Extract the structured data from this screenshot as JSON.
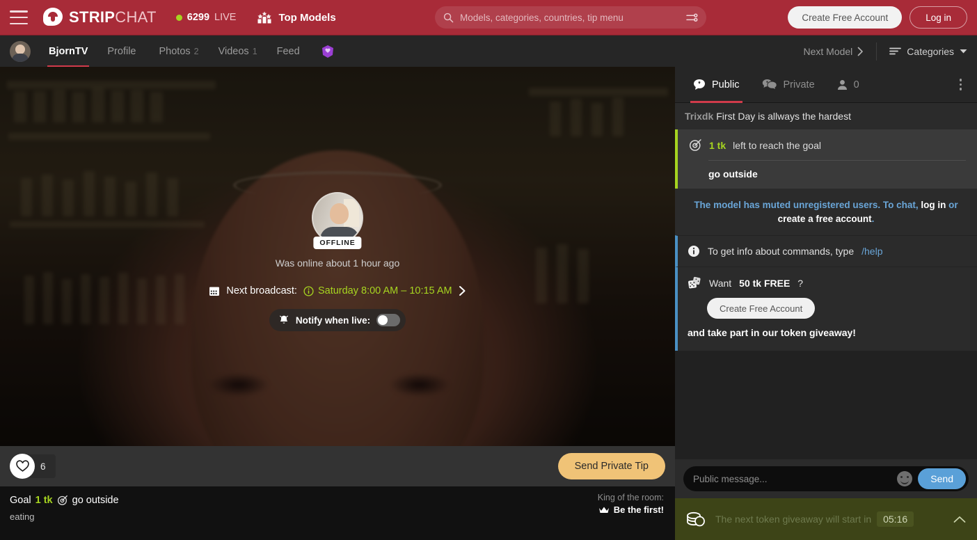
{
  "header": {
    "menu_icon": "hamburger-menu-icon",
    "logo_part1": "STRIP",
    "logo_part2": "CHAT",
    "live_count": "6299",
    "live_label": "LIVE",
    "top_models_label": "Top Models",
    "search_placeholder": "Models, categories, countries, tip menu",
    "search_value": "",
    "filter_icon": "filter-sliders-icon",
    "create_account_label": "Create Free Account",
    "login_label": "Log in",
    "brand_color": "#a82b38",
    "live_dot_color": "#a6d420"
  },
  "subnav": {
    "model_name": "BjornTV",
    "items": [
      {
        "label": "Profile",
        "count": ""
      },
      {
        "label": "Photos",
        "count": "2"
      },
      {
        "label": "Videos",
        "count": "1"
      },
      {
        "label": "Feed",
        "count": ""
      }
    ],
    "fanclub_icon": "fanclub-badge-icon",
    "next_model_label": "Next Model",
    "categories_label": "Categories"
  },
  "video": {
    "status_badge": "OFFLINE",
    "last_online": "Was online about 1 hour ago",
    "next_broadcast_label": "Next broadcast:",
    "next_broadcast_time": "Saturday 8:00 AM – 10:15 AM",
    "notify_label": "Notify when live:",
    "notify_enabled": false,
    "calendar_icon": "calendar-icon",
    "info_icon": "info-circle-icon",
    "bell_icon": "bell-icon",
    "chevron_icon": "chevron-right-icon"
  },
  "video_actions": {
    "like_icon": "heart-icon",
    "like_count": "6",
    "tip_label": "Send Private Tip",
    "tip_color": "#f0c377"
  },
  "goal_strip": {
    "goal_label": "Goal",
    "goal_amount": "1 tk",
    "goal_icon": "target-icon",
    "goal_desc": "go outside",
    "subtitle": "eating",
    "king_label": "King of the room:",
    "king_value": "Be the first!",
    "crown_icon": "crown-icon",
    "accent_color": "#a6d420"
  },
  "chat": {
    "tabs": [
      {
        "label": "Public",
        "icon": "speech-bubble-icon",
        "active": true
      },
      {
        "label": "Private",
        "icon": "private-chat-icon",
        "active": false
      }
    ],
    "viewers_icon": "user-icon",
    "viewers_count": "0",
    "kebab_icon": "more-options-icon",
    "messages": {
      "user_msg": {
        "user": "Trixdk",
        "text": "First Day is allways the hardest"
      },
      "goal_msg": {
        "icon": "target-icon",
        "amount": "1 tk",
        "text": "left to reach the goal",
        "description": "go outside",
        "border_color": "#a6d420"
      },
      "muted_msg": {
        "part1": "The model has muted unregistered users. To chat,",
        "link1": "log in",
        "joiner": "or",
        "link2": "create a free account",
        "period": ".",
        "link_color": "#6aa6d8"
      },
      "info_msg": {
        "icon": "info-circle-icon",
        "text": "To get info about commands, type",
        "command": "/help",
        "border_color": "#4a90c4"
      },
      "giveaway_msg": {
        "icon": "dice-icon",
        "prefix": "Want",
        "amount": "50 tk FREE",
        "suffix": "?",
        "button_label": "Create Free Account",
        "tail": "and take part in our token giveaway!",
        "border_color": "#4a90c4"
      }
    },
    "input_placeholder": "Public message...",
    "input_value": "",
    "emoji_icon": "emoji-smiley-icon",
    "send_label": "Send",
    "send_color": "#5aa0d8"
  },
  "giveaway_bar": {
    "icon": "coins-icon",
    "text": "The next token giveaway will start in",
    "timer": "05:16",
    "chevron_icon": "chevron-up-icon",
    "background": "#3d4417"
  }
}
